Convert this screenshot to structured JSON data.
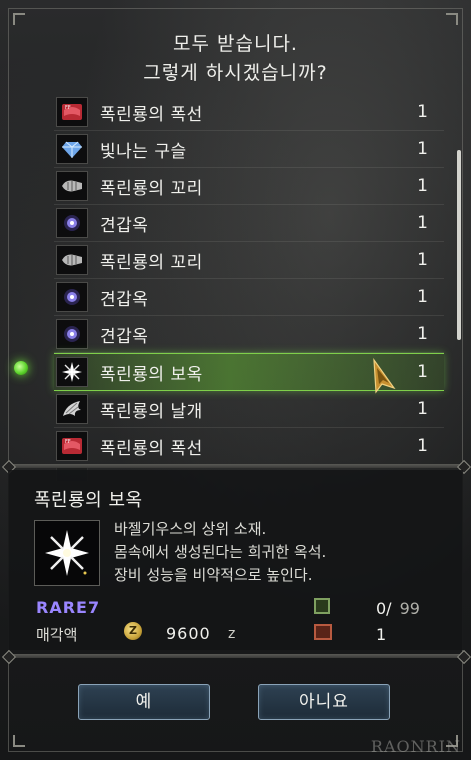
{
  "dialog": {
    "prompt_line1": "모두 받습니다.",
    "prompt_line2": "그렇게 하시겠습니까?"
  },
  "items": [
    {
      "name": "폭린룡의 폭선",
      "qty": "1",
      "icon": "red-membrane-icon",
      "color": "#c0333a"
    },
    {
      "name": "빛나는 구슬",
      "qty": "1",
      "icon": "blue-gem-icon",
      "color": "#7fb2f0"
    },
    {
      "name": "폭린룡의 꼬리",
      "qty": "1",
      "icon": "tail-icon",
      "color": "#c8c8c8"
    },
    {
      "name": "견갑옥",
      "qty": "1",
      "icon": "purple-orb-icon",
      "color": "#8a80e8"
    },
    {
      "name": "폭린룡의 꼬리",
      "qty": "1",
      "icon": "tail-icon",
      "color": "#c8c8c8"
    },
    {
      "name": "견갑옥",
      "qty": "1",
      "icon": "purple-orb-icon",
      "color": "#8a80e8"
    },
    {
      "name": "견갑옥",
      "qty": "1",
      "icon": "purple-orb-icon",
      "color": "#8a80e8"
    },
    {
      "name": "폭린룡의 보옥",
      "qty": "1",
      "icon": "white-star-gem-icon",
      "color": "#ffffff",
      "selected": true
    },
    {
      "name": "폭린룡의 날개",
      "qty": "1",
      "icon": "wing-icon",
      "color": "#d8d8d8"
    },
    {
      "name": "폭린룡의 폭선",
      "qty": "1",
      "icon": "red-membrane-icon",
      "color": "#c0333a"
    }
  ],
  "detail": {
    "title": "폭린룡의 보옥",
    "desc_line1": "바젤기우스의 상위 소재.",
    "desc_line2": "몸속에서 생성된다는 희귀한 옥석.",
    "desc_line3": "장비 성능을 비약적으로 높인다.",
    "rarity": "RARE7",
    "price_label": "매각액",
    "zeny_symbol": "Z",
    "price": "9600",
    "price_unit": "z",
    "owned": "0/",
    "owned_max": "99",
    "stash": "1",
    "rarity_color": "#9a86ff"
  },
  "buttons": {
    "yes": "예",
    "no": "아니요"
  },
  "watermark": "RAONRIN"
}
